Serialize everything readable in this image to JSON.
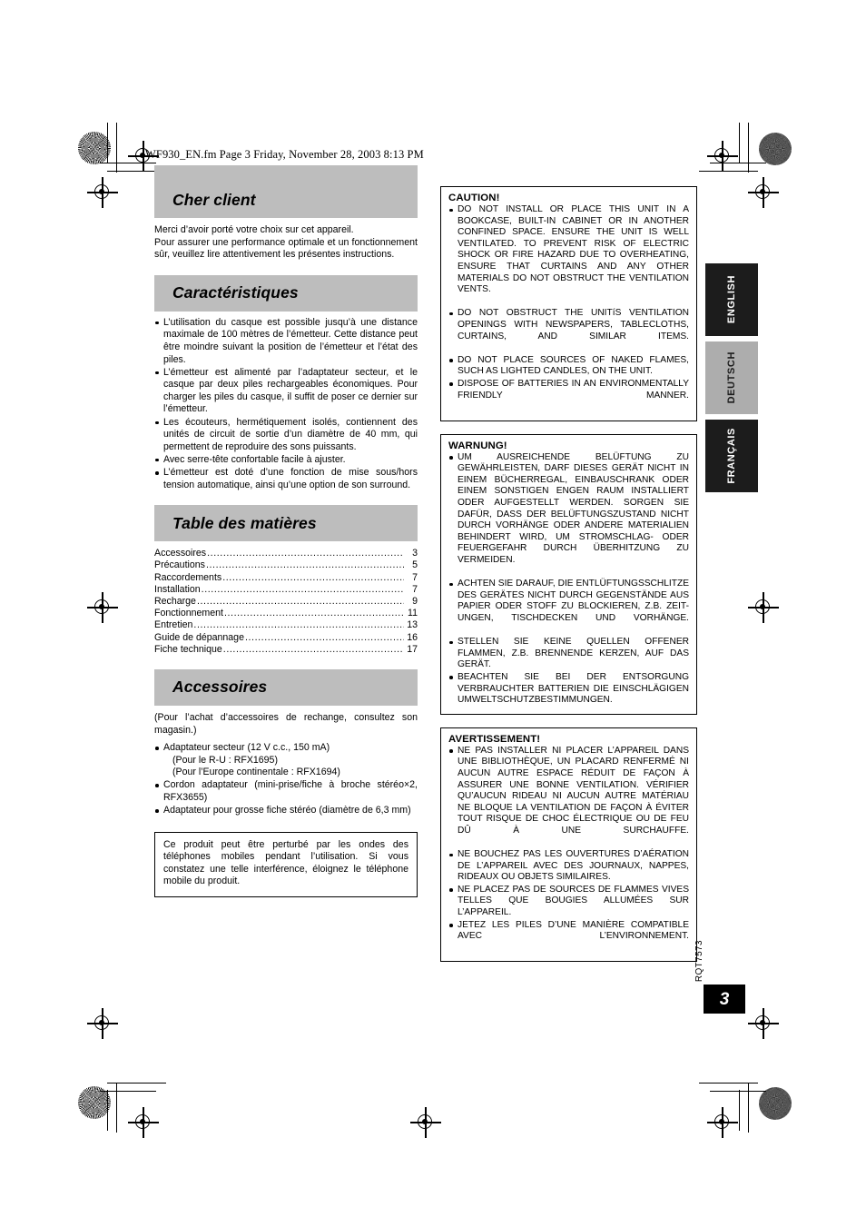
{
  "print_marks": {
    "file_header": "WF930_EN.fm  Page 3  Friday, November 28, 2003  8:13 PM"
  },
  "left_column": {
    "sections": [
      {
        "id": "cher-client",
        "heading": "Cher client",
        "paragraphs": [
          "Merci d’avoir porté votre choix sur cet appareil.",
          "Pour assurer une performance optimale et un fonctionnement sûr, veuillez lire attentivement les présentes instructions."
        ]
      },
      {
        "id": "caracteristiques",
        "heading": "Caractéristiques",
        "bullets": [
          "L’utilisation du casque est possible jusqu’à une distance maximale de 100 mètres de l’émetteur. Cette distance peut être moindre suivant la position de l’émetteur et l’état des piles.",
          "L’émetteur est alimenté par l’adaptateur secteur, et le casque par deux piles rechargeables économiques. Pour charger les piles du casque, il suffit de poser ce dernier sur l’émetteur.",
          "Les écouteurs, hermétiquement isolés, contiennent des unités de circuit de sortie d’un diamètre de 40 mm, qui permettent de reproduire des sons puissants.",
          "Avec serre-tête confortable facile à ajuster.",
          "L’émetteur est doté d’une fonction de mise sous/hors tension automatique, ainsi qu’une option de son surround."
        ]
      },
      {
        "id": "table-des-matieres",
        "heading": "Table des matières",
        "toc": [
          {
            "label": "Accessoires",
            "page": "3"
          },
          {
            "label": "Précautions",
            "page": "5"
          },
          {
            "label": "Raccordements",
            "page": "7"
          },
          {
            "label": "Installation",
            "page": "7"
          },
          {
            "label": "Recharge",
            "page": "9"
          },
          {
            "label": "Fonctionnement",
            "page": "11"
          },
          {
            "label": "Entretien",
            "page": "13"
          },
          {
            "label": "Guide de dépannage",
            "page": "16"
          },
          {
            "label": "Fiche technique",
            "page": "17"
          }
        ]
      },
      {
        "id": "accessoires",
        "heading": "Accessoires",
        "intro": "(Pour l’achat d’accessoires de rechange, consultez son magasin.)",
        "bullets": [
          {
            "main": "Adaptateur secteur (12 V c.c., 150 mA)",
            "subs": [
              "(Pour le R-U : RFX1695)",
              "(Pour l’Europe continentale : RFX1694)"
            ]
          },
          {
            "main": "Cordon adaptateur (mini-prise/fiche à broche stéréo×2, RFX3655)",
            "subs": []
          },
          {
            "main": "Adaptateur pour grosse fiche stéréo (diamètre de 6,3 mm)",
            "subs": []
          }
        ]
      }
    ],
    "note_box": "Ce produit peut être perturbé par les ondes des téléphones mobiles pendant l’utilisation. Si vous constatez une telle interférence, éloignez le téléphone mobile du produit."
  },
  "right_column": {
    "boxes": [
      {
        "id": "caution",
        "title": "CAUTION!",
        "items": [
          "DO NOT INSTALL OR PLACE THIS UNIT IN A BOOKCASE, BUILT-IN CABINET OR IN ANOTHER CONFINED SPACE. ENSURE THE UNIT IS WELL VENTILATED. TO PREVENT RISK OF ELECTRIC SHOCK OR FIRE HAZARD DUE TO OVERHEATING, ENSURE THAT CURTAINS AND ANY OTHER MATERIALS DO NOT OBSTRUCT THE VENTILATION VENTS.",
          "DO NOT OBSTRUCT THE UNITíS VENTILATION OPENINGS WITH NEWSPAPERS, TABLECLOTHS, CURTAINS, AND SIMILAR ITEMS.",
          "DO NOT PLACE SOURCES OF NAKED FLAMES, SUCH AS LIGHTED CANDLES, ON THE UNIT.",
          "DISPOSE OF BATTERIES IN AN ENVIRONMENTALLY FRIENDLY MANNER."
        ]
      },
      {
        "id": "warnung",
        "title": "WARNUNG!",
        "items": [
          "UM AUSREICHENDE BELÜFTUNG ZU GEWÄHRLEISTEN, DARF DIESES GERÄT NICHT IN EINEM BÜCHERREGAL, EINBAUSCHRANK ODER EINEM SONSTIGEN ENGEN RAUM INSTALLIERT ODER AUFGESTELLT WERDEN. SORGEN SIE DAFÜR, DASS DER BELÜFTUNGSZUSTAND NICHT DURCH VORHÄNGE ODER ANDERE MATERIALIEN BEHINDERT WIRD, UM STROMSCHLAG- ODER FEUERGEFAHR DURCH ÜBERHITZUNG ZU VERMEIDEN.",
          "ACHTEN SIE DARAUF, DIE ENTLÜFTUNGSSCHLITZE DES GERÄTES NICHT DURCH GEGENSTÄNDE AUS PAPIER ODER STOFF ZU BLOCKIEREN, Z.B. ZEIT-UNGEN, TISCHDECKEN UND VORHÄNGE.",
          "STELLEN SIE KEINE QUELLEN OFFENER FLAMMEN, Z.B. BRENNENDE KERZEN, AUF DAS GERÄT.",
          "BEACHTEN SIE BEI DER ENTSORGUNG VERBRAUCHTER BATTERIEN DIE EINSCHLÄGIGEN UMWELTSCHUTZBESTIMMUNGEN."
        ]
      },
      {
        "id": "avertissement",
        "title": "AVERTISSEMENT!",
        "items": [
          "NE PAS INSTALLER NI PLACER L’APPAREIL DANS UNE BIBLIOTHÈQUE, UN PLACARD RENFERMÉ NI AUCUN AUTRE ESPACE RÉDUIT DE FAÇON À ASSURER UNE BONNE VENTILATION. VÉRIFIER QU’AUCUN RIDEAU NI AUCUN AUTRE MATÉRIAU NE BLOQUE LA VENTILATION DE FAÇON À ÉVITER TOUT RISQUE DE CHOC ÉLECTRIQUE OU DE FEU DÛ À UNE SURCHAUFFE.",
          "NE BOUCHEZ PAS LES OUVERTURES D’AÉRATION DE L’APPAREIL AVEC DES JOURNAUX, NAPPES, RIDEAUX OU OBJETS SIMILAIRES.",
          "NE PLACEZ PAS DE SOURCES DE FLAMMES VIVES TELLES QUE BOUGIES ALLUMÉES SUR L’APPAREIL.",
          "JETEZ LES PILES D’UNE MANIÈRE COMPATIBLE AVEC L’ENVIRONNEMENT."
        ]
      }
    ]
  },
  "language_tabs": [
    {
      "label": "ENGLISH",
      "active": false
    },
    {
      "label": "DEUTSCH",
      "active": true
    },
    {
      "label": "FRANÇAIS",
      "active": false
    }
  ],
  "footer": {
    "rqt_code": "RQT7573",
    "page_number": "3"
  },
  "colors": {
    "heading_band": "#bdbdbd",
    "tab_dark": "#1c1c1c",
    "tab_light": "#adadad",
    "folio_bg": "#000000"
  }
}
